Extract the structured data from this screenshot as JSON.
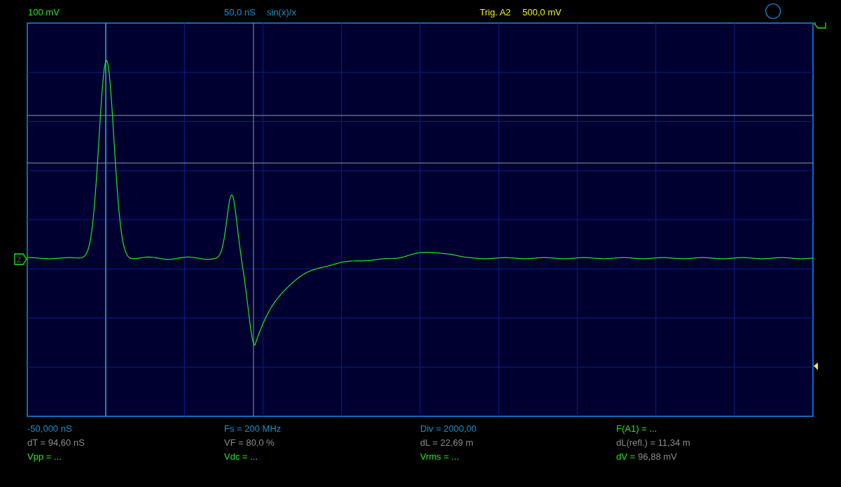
{
  "header": {
    "channel_scale": "100 mV",
    "timebase": "50,0 nS",
    "interpolation": "sin(x)/x",
    "trigger": "Trig. A2",
    "trigger_level": "500,0 mV"
  },
  "ground_marker": {
    "label": "Z"
  },
  "readout_columns": [
    {
      "items": [
        {
          "kind": "setting",
          "text": "-50,000 nS"
        },
        {
          "kind": "measure",
          "text": "dT = 94,60 nS"
        },
        {
          "kind": "result",
          "text": "Vpp = ..."
        }
      ]
    },
    {
      "items": [
        {
          "kind": "setting",
          "text": "Fs = 200 MHz"
        },
        {
          "kind": "measure",
          "text": "VF = 80,0 %"
        },
        {
          "kind": "result",
          "text": "Vdc = ..."
        }
      ]
    },
    {
      "items": [
        {
          "kind": "setting",
          "text": "Div = 2000,00"
        },
        {
          "kind": "measure",
          "text": "dL = 22,69 m"
        },
        {
          "kind": "result",
          "text": "Vrms = ..."
        }
      ]
    },
    {
      "items": [
        {
          "kind": "result",
          "text": "F(A1) = ..."
        },
        {
          "kind": "measure",
          "text": "dL(refl.) = 11,34 m"
        },
        {
          "kind": "result",
          "text": "dV =",
          "value": "96,88 mV"
        }
      ]
    }
  ]
}
